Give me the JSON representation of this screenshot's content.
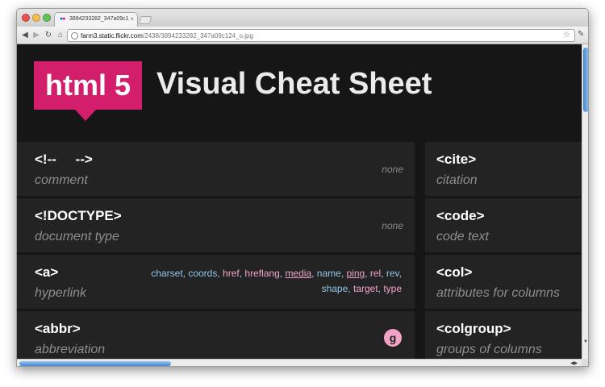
{
  "browser": {
    "tab": {
      "title": "3894233282_347a09c124_o.jpg",
      "close_glyph": "×"
    },
    "address": {
      "host": "farm3.static.flickr.com",
      "path": "/2438/3894233282_347a09c124_o.jpg"
    },
    "icons": {
      "back": "back-arrow-icon",
      "forward": "forward-arrow-icon",
      "reload": "reload-icon",
      "home": "home-icon",
      "star": "star-icon",
      "wrench": "wrench-icon"
    }
  },
  "page": {
    "logo": "html 5",
    "title": "Visual Cheat Sheet",
    "colors": {
      "accent": "#d31f6b",
      "background": "#161616",
      "card": "#232323",
      "attr_blue": "#8fc7e8",
      "attr_pink": "#f2a3c5"
    },
    "left_entries": [
      {
        "tag": "<!--     -->",
        "desc": "comment",
        "note": "none"
      },
      {
        "tag": "<!DOCTYPE>",
        "desc": "document type",
        "note": "none"
      },
      {
        "tag": "<a>",
        "desc": "hyperlink",
        "attrs": [
          {
            "name": "charset",
            "color": "blue"
          },
          {
            "name": "coords",
            "color": "blue"
          },
          {
            "name": "href",
            "color": "pink"
          },
          {
            "name": "hreflang",
            "color": "pink"
          },
          {
            "name": "media",
            "color": "pink",
            "underline": true
          },
          {
            "name": "name",
            "color": "blue"
          },
          {
            "name": "ping",
            "color": "pink",
            "underline": true
          },
          {
            "name": "rel",
            "color": "pink"
          },
          {
            "name": "rev",
            "color": "blue"
          },
          {
            "name": "shape",
            "color": "blue"
          },
          {
            "name": "target",
            "color": "pink"
          },
          {
            "name": "type",
            "color": "pink"
          }
        ]
      },
      {
        "tag": "<abbr>",
        "desc": "abbreviation",
        "badge": "g"
      }
    ],
    "right_entries": [
      {
        "tag": "<cite>",
        "desc": "citation"
      },
      {
        "tag": "<code>",
        "desc": "code text"
      },
      {
        "tag": "<col>",
        "desc": "attributes for columns"
      },
      {
        "tag": "<colgroup>",
        "desc": "groups of columns"
      }
    ]
  }
}
